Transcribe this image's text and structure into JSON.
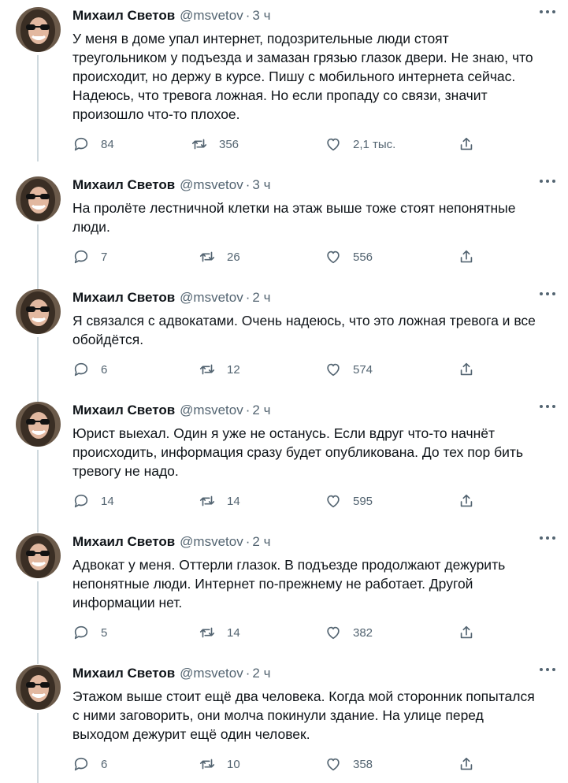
{
  "tweets": [
    {
      "name": "Михаил Светов",
      "handle": "@msvetov",
      "separator": "·",
      "time": "3 ч",
      "text": "У меня в доме упал интернет, подозрительные люди стоят\nтреугольником у подъезда и замазан грязью глазок двери. Не знаю, что\nпроисходит, но держу в курсе. Пишу с мобильного интернета сейчас.\nНадеюсь, что тревога ложная. Но если пропаду со связи, значит\nпроизошло что-то плохое.",
      "replies": "84",
      "retweets": "356",
      "likes": "2,1 тыс."
    },
    {
      "name": "Михаил Светов",
      "handle": "@msvetov",
      "separator": "·",
      "time": "3 ч",
      "text": "На пролёте лестничной клетки на этаж выше тоже стоят непонятные\nлюди.",
      "replies": "7",
      "retweets": "26",
      "likes": "556"
    },
    {
      "name": "Михаил Светов",
      "handle": "@msvetov",
      "separator": "·",
      "time": "2 ч",
      "text": "Я связался с адвокатами. Очень надеюсь, что это ложная тревога и все\nобойдётся.",
      "replies": "6",
      "retweets": "12",
      "likes": "574"
    },
    {
      "name": "Михаил Светов",
      "handle": "@msvetov",
      "separator": "·",
      "time": "2 ч",
      "text": "Юрист выехал. Один я уже не останусь. Если вдруг что-то начнёт\nпроисходить, информация сразу будет опубликована. До тех пор бить\nтревогу не надо.",
      "replies": "14",
      "retweets": "14",
      "likes": "595"
    },
    {
      "name": "Михаил Светов",
      "handle": "@msvetov",
      "separator": "·",
      "time": "2 ч",
      "text": "Адвокат у меня. Оттерли глазок. В подъезде продолжают дежурить\nнепонятные люди. Интернет по-прежнему не работает. Другой\nинформации нет.",
      "replies": "5",
      "retweets": "14",
      "likes": "382"
    },
    {
      "name": "Михаил Светов",
      "handle": "@msvetov",
      "separator": "·",
      "time": "2 ч",
      "text": "Этажом выше стоит ещё два человека. Когда мой сторонник попытался\nс ними заговорить, они молча покинули здание. На улице перед\nвыходом дежурит ещё один человек.",
      "replies": "6",
      "retweets": "10",
      "likes": "358"
    }
  ],
  "icons": {
    "reply": "reply-icon",
    "retweet": "retweet-icon",
    "like": "heart-icon",
    "share": "share-icon",
    "more": "more-icon"
  },
  "colors": {
    "text": "#0f1419",
    "muted": "#536471",
    "thread_line": "#cfd9de",
    "background": "#ffffff"
  }
}
